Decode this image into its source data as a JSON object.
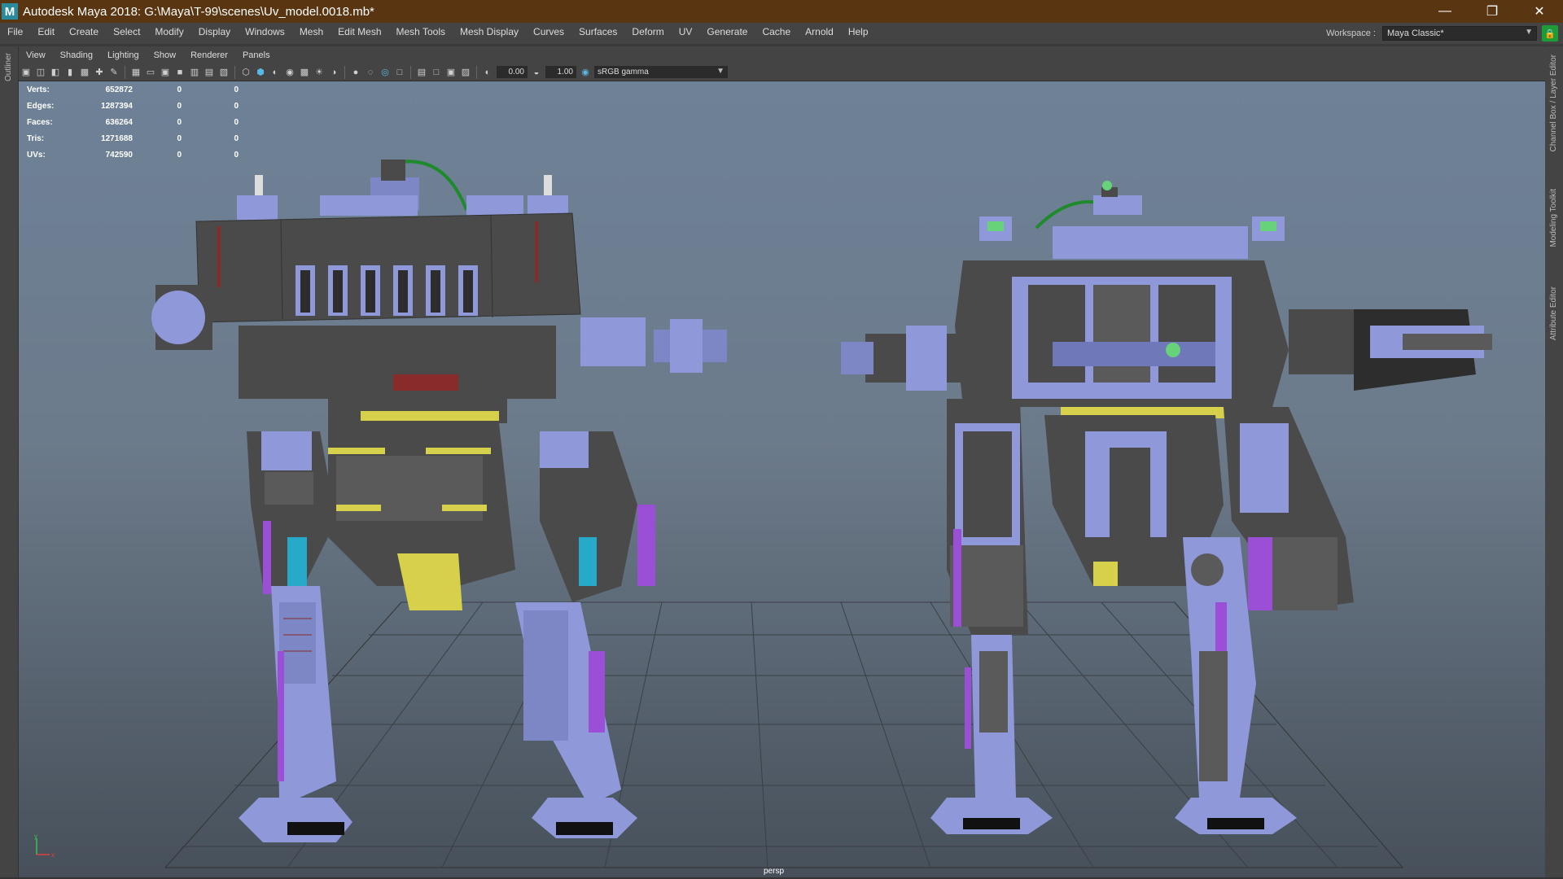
{
  "window": {
    "title": "Autodesk Maya 2018: G:\\Maya\\T-99\\scenes\\Uv_model.0018.mb*",
    "logo_letter": "M",
    "minimize": "—",
    "restore": "❐",
    "close": "✕"
  },
  "menus": [
    "File",
    "Edit",
    "Create",
    "Select",
    "Modify",
    "Display",
    "Windows",
    "Mesh",
    "Edit Mesh",
    "Mesh Tools",
    "Mesh Display",
    "Curves",
    "Surfaces",
    "Deform",
    "UV",
    "Generate",
    "Cache",
    "Arnold",
    "Help"
  ],
  "workspace": {
    "label": "Workspace :",
    "value": "Maya Classic*"
  },
  "side_tabs": {
    "left": "Outliner",
    "right": [
      "Channel Box / Layer Editor",
      "Modeling Toolkit",
      "Attribute Editor"
    ]
  },
  "panel_menus": [
    "View",
    "Shading",
    "Lighting",
    "Show",
    "Renderer",
    "Panels"
  ],
  "toolbar": {
    "exposure": "0.00",
    "gamma": "1.00",
    "color_space": "sRGB gamma"
  },
  "hud": [
    {
      "label": "Verts:",
      "v1": "652872",
      "v2": "0",
      "v3": "0"
    },
    {
      "label": "Edges:",
      "v1": "1287394",
      "v2": "0",
      "v3": "0"
    },
    {
      "label": "Faces:",
      "v1": "636264",
      "v2": "0",
      "v3": "0"
    },
    {
      "label": "Tris:",
      "v1": "1271688",
      "v2": "0",
      "v3": "0"
    },
    {
      "label": "UVs:",
      "v1": "742590",
      "v2": "0",
      "v3": "0"
    }
  ],
  "viewport": {
    "camera": "persp",
    "axis_y": "y",
    "axis_x": "x"
  },
  "colors": {
    "titlebar": "#5a3512",
    "mesh_gray": "#4a4a4a",
    "mesh_blue": "#8f98d8",
    "accent_purple": "#9a4fd6",
    "accent_yellow": "#d6d04a",
    "accent_cyan": "#27a9c9",
    "cable_green": "#1e8a2c"
  }
}
